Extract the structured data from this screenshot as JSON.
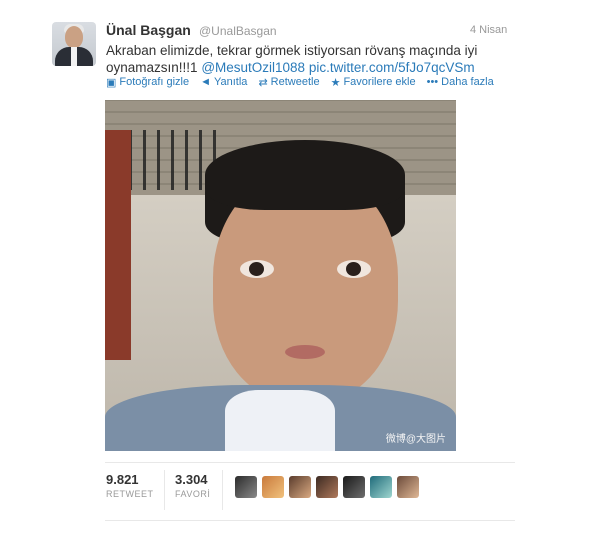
{
  "tweet": {
    "display_name": "Ünal Başgan",
    "handle": "@UnalBasgan",
    "date": "4 Nisan",
    "text_plain": "Akraban elimizde, tekrar görmek istiyorsan rövanş maçında iyi oynamazsın!!!1 ",
    "mention": "@MesutOzil1088",
    "link": "pic.twitter.com/5fJo7qcVSm",
    "photo_watermark": "微博@大图片"
  },
  "actions": [
    {
      "icon": "photo-icon",
      "label": "Fotoğrafı gizle"
    },
    {
      "icon": "reply-icon",
      "label": "Yanıtla"
    },
    {
      "icon": "retweet-icon",
      "label": "Retweetle"
    },
    {
      "icon": "star-icon",
      "label": "Favorilere ekle"
    },
    {
      "icon": "more-icon",
      "label": "Daha fazla"
    }
  ],
  "stats": {
    "retweet_count": "9.821",
    "retweet_label": "RETWEET",
    "favorite_count": "3.304",
    "favorite_label": "FAVORİ"
  },
  "colors": {
    "link": "#2b7bb9",
    "muted": "#999999",
    "text": "#333333"
  }
}
